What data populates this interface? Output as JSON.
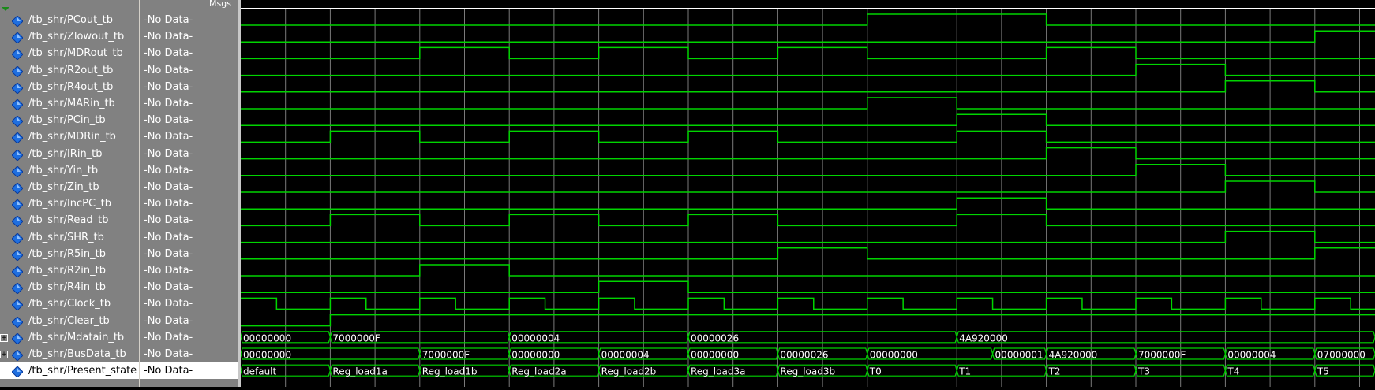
{
  "header": {
    "names_label": "",
    "values_label": "Msgs"
  },
  "colors": {
    "wave": "#00d400",
    "cursor_grid": "#c8c8c8",
    "panel_bg": "#818181",
    "diamond": "#1f6fe0"
  },
  "signals": [
    {
      "name": "/tb_shr/PCout_tb",
      "value": "-No Data-",
      "type": "bit",
      "levels": [
        0,
        0,
        0,
        0,
        0,
        0,
        0,
        1,
        1,
        0,
        0,
        0,
        0
      ]
    },
    {
      "name": "/tb_shr/Zlowout_tb",
      "value": "-No Data-",
      "type": "bit",
      "levels": [
        0,
        0,
        0,
        0,
        0,
        0,
        0,
        0,
        0,
        0,
        0,
        0,
        1
      ]
    },
    {
      "name": "/tb_shr/MDRout_tb",
      "value": "-No Data-",
      "type": "bit",
      "levels": [
        0,
        0,
        1,
        0,
        1,
        0,
        1,
        0,
        0,
        1,
        0,
        0,
        0
      ]
    },
    {
      "name": "/tb_shr/R2out_tb",
      "value": "-No Data-",
      "type": "bit",
      "levels": [
        0,
        0,
        0,
        0,
        0,
        0,
        0,
        0,
        0,
        0,
        1,
        0,
        0
      ]
    },
    {
      "name": "/tb_shr/R4out_tb",
      "value": "-No Data-",
      "type": "bit",
      "levels": [
        0,
        0,
        0,
        0,
        0,
        0,
        0,
        0,
        0,
        0,
        0,
        1,
        0
      ]
    },
    {
      "name": "/tb_shr/MARin_tb",
      "value": "-No Data-",
      "type": "bit",
      "levels": [
        0,
        0,
        0,
        0,
        0,
        0,
        0,
        1,
        0,
        0,
        0,
        0,
        0
      ]
    },
    {
      "name": "/tb_shr/PCin_tb",
      "value": "-No Data-",
      "type": "bit",
      "levels": [
        0,
        0,
        0,
        0,
        0,
        0,
        0,
        0,
        1,
        0,
        0,
        0,
        0
      ]
    },
    {
      "name": "/tb_shr/MDRin_tb",
      "value": "-No Data-",
      "type": "bit",
      "levels": [
        0,
        1,
        0,
        1,
        0,
        1,
        0,
        0,
        1,
        0,
        0,
        0,
        0
      ]
    },
    {
      "name": "/tb_shr/IRin_tb",
      "value": "-No Data-",
      "type": "bit",
      "levels": [
        0,
        0,
        0,
        0,
        0,
        0,
        0,
        0,
        0,
        1,
        0,
        0,
        0
      ]
    },
    {
      "name": "/tb_shr/Yin_tb",
      "value": "-No Data-",
      "type": "bit",
      "levels": [
        0,
        0,
        0,
        0,
        0,
        0,
        0,
        0,
        0,
        0,
        1,
        0,
        0
      ]
    },
    {
      "name": "/tb_shr/Zin_tb",
      "value": "-No Data-",
      "type": "bit",
      "levels": [
        0,
        0,
        0,
        0,
        0,
        0,
        0,
        0,
        0,
        0,
        0,
        1,
        0
      ]
    },
    {
      "name": "/tb_shr/IncPC_tb",
      "value": "-No Data-",
      "type": "bit",
      "levels": [
        0,
        0,
        0,
        0,
        0,
        0,
        0,
        0,
        1,
        0,
        0,
        0,
        0
      ]
    },
    {
      "name": "/tb_shr/Read_tb",
      "value": "-No Data-",
      "type": "bit",
      "levels": [
        0,
        1,
        0,
        1,
        0,
        1,
        0,
        0,
        1,
        0,
        0,
        0,
        0
      ]
    },
    {
      "name": "/tb_shr/SHR_tb",
      "value": "-No Data-",
      "type": "bit",
      "levels": [
        0,
        0,
        0,
        0,
        0,
        0,
        0,
        0,
        0,
        0,
        0,
        1,
        0
      ]
    },
    {
      "name": "/tb_shr/R5in_tb",
      "value": "-No Data-",
      "type": "bit",
      "levels": [
        0,
        0,
        0,
        0,
        0,
        0,
        1,
        0,
        0,
        0,
        0,
        0,
        1
      ]
    },
    {
      "name": "/tb_shr/R2in_tb",
      "value": "-No Data-",
      "type": "bit",
      "levels": [
        0,
        0,
        1,
        0,
        0,
        0,
        0,
        0,
        0,
        0,
        0,
        0,
        0
      ]
    },
    {
      "name": "/tb_shr/R4in_tb",
      "value": "-No Data-",
      "type": "bit",
      "levels": [
        0,
        0,
        0,
        0,
        1,
        0,
        0,
        0,
        0,
        0,
        0,
        0,
        0
      ]
    },
    {
      "name": "/tb_shr/Clock_tb",
      "value": "-No Data-",
      "type": "clock"
    },
    {
      "name": "/tb_shr/Clear_tb",
      "value": "-No Data-",
      "type": "clear"
    },
    {
      "name": "/tb_shr/Mdatain_tb",
      "value": "-No Data-",
      "type": "bus",
      "expandable": true,
      "segments": [
        {
          "start": 0,
          "end": 1,
          "label": "00000000"
        },
        {
          "start": 1,
          "end": 3,
          "label": "7000000F"
        },
        {
          "start": 3,
          "end": 5,
          "label": "00000004"
        },
        {
          "start": 5,
          "end": 8,
          "label": "00000026"
        },
        {
          "start": 8,
          "end": 13,
          "label": "4A920000"
        }
      ]
    },
    {
      "name": "/tb_shr/BusData_tb",
      "value": "-No Data-",
      "type": "bus",
      "expandable": true,
      "segments": [
        {
          "start": 0,
          "end": 2,
          "label": "00000000"
        },
        {
          "start": 2,
          "end": 3,
          "label": "7000000F"
        },
        {
          "start": 3,
          "end": 4,
          "label": "00000000"
        },
        {
          "start": 4,
          "end": 5,
          "label": "00000004"
        },
        {
          "start": 5,
          "end": 6,
          "label": "00000000"
        },
        {
          "start": 6,
          "end": 7,
          "label": "00000026"
        },
        {
          "start": 7,
          "end": 8.4,
          "label": "00000000"
        },
        {
          "start": 8.4,
          "end": 9,
          "label": "00000001"
        },
        {
          "start": 9,
          "end": 10,
          "label": "4A920000"
        },
        {
          "start": 10,
          "end": 11,
          "label": "7000000F"
        },
        {
          "start": 11,
          "end": 12,
          "label": "00000004"
        },
        {
          "start": 12,
          "end": 13,
          "label": "07000000"
        }
      ]
    },
    {
      "name": "/tb_shr/Present_state",
      "value": "-No Data-",
      "type": "bus",
      "selected": true,
      "segments": [
        {
          "start": 0,
          "end": 1,
          "label": "default"
        },
        {
          "start": 1,
          "end": 2,
          "label": "Reg_load1a"
        },
        {
          "start": 2,
          "end": 3,
          "label": "Reg_load1b"
        },
        {
          "start": 3,
          "end": 4,
          "label": "Reg_load2a"
        },
        {
          "start": 4,
          "end": 5,
          "label": "Reg_load2b"
        },
        {
          "start": 5,
          "end": 6,
          "label": "Reg_load3a"
        },
        {
          "start": 6,
          "end": 7,
          "label": "Reg_load3b"
        },
        {
          "start": 7,
          "end": 8,
          "label": "T0"
        },
        {
          "start": 8,
          "end": 9,
          "label": "T1"
        },
        {
          "start": 9,
          "end": 10,
          "label": "T2"
        },
        {
          "start": 10,
          "end": 11,
          "label": "T3"
        },
        {
          "start": 11,
          "end": 12,
          "label": "T4"
        },
        {
          "start": 12,
          "end": 13,
          "label": "T5"
        }
      ]
    }
  ]
}
